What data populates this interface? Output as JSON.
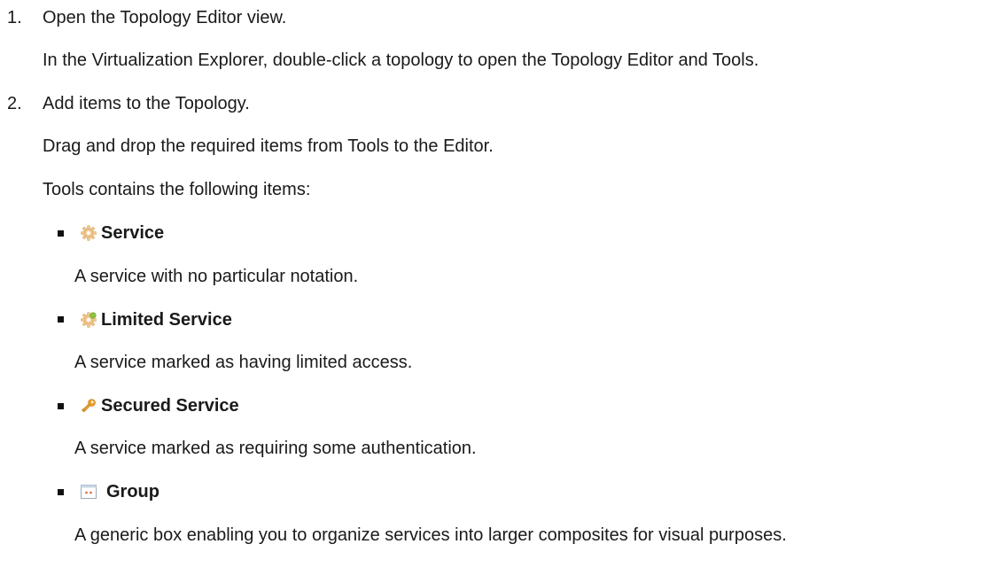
{
  "steps": [
    {
      "number": "1.",
      "title": "Open the Topology Editor view.",
      "text": "In the Virtualization Explorer, double-click a topology to open the Topology Editor and Tools."
    },
    {
      "number": "2.",
      "title": "Add items to the Topology.",
      "text": "Drag and drop the required items from Tools to the Editor.",
      "intro": "Tools contains the following items:"
    }
  ],
  "items": [
    {
      "label": "Service",
      "icon": "gear-icon",
      "description": "A service with no particular notation."
    },
    {
      "label": "Limited Service",
      "icon": "gear-limited-icon",
      "description": "A service marked as having limited access."
    },
    {
      "label": "Secured Service",
      "icon": "key-icon",
      "description": "A service marked as requiring some authentication."
    },
    {
      "label": "Group",
      "icon": "group-box-icon",
      "description": "A generic box enabling you to organize services into larger composites for visual purposes."
    }
  ],
  "colors": {
    "text": "#1a1a1a",
    "gear": "#f0c890",
    "limited_badge": "#8cc63f",
    "key": "#e8a030",
    "group_header": "#c8d8e8",
    "group_dot": "#e06040"
  }
}
